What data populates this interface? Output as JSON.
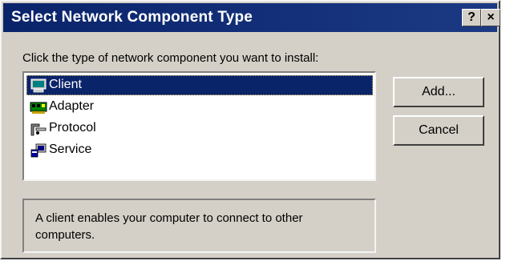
{
  "window": {
    "title": "Select Network Component Type"
  },
  "titlebar_buttons": {
    "help_label": "?",
    "close_label": "×"
  },
  "prompt": "Click the type of network component you want to install:",
  "list": {
    "items": [
      {
        "label": "Client",
        "icon": "client-computer-icon",
        "selected": true
      },
      {
        "label": "Adapter",
        "icon": "network-adapter-icon",
        "selected": false
      },
      {
        "label": "Protocol",
        "icon": "protocol-icon",
        "selected": false
      },
      {
        "label": "Service",
        "icon": "service-icon",
        "selected": false
      }
    ]
  },
  "buttons": {
    "add_label": "Add...",
    "cancel_label": "Cancel"
  },
  "description": "A client enables your computer to connect to other computers.",
  "colors": {
    "titlebar": "#0a246a",
    "face": "#d4d0c8",
    "selection": "#0a246a"
  }
}
